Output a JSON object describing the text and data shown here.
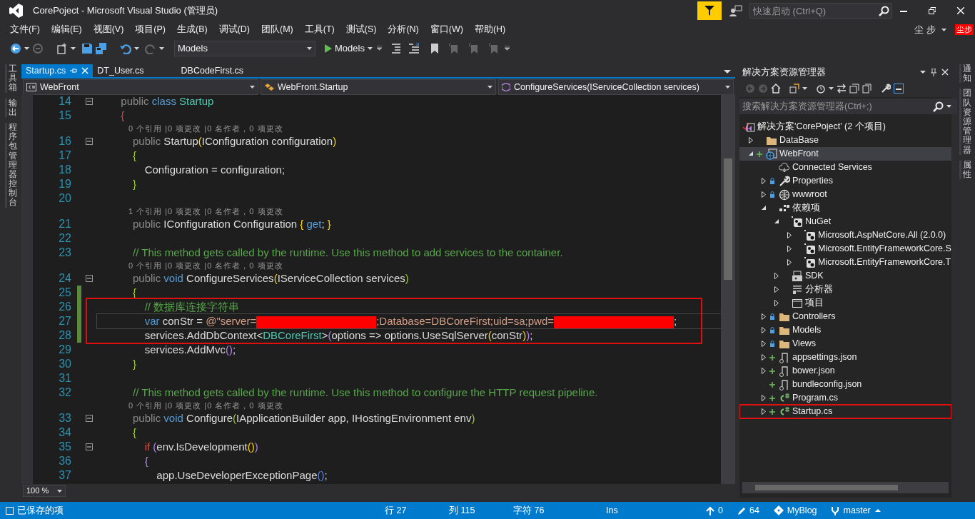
{
  "window": {
    "title": "CorePoject - Microsoft Visual Studio (管理员)",
    "quick_launch": {
      "placeholder": "快速启动 (Ctrl+Q)"
    },
    "user": "尘步",
    "avatar": "尘步"
  },
  "menu": [
    "文件(F)",
    "编辑(E)",
    "视图(V)",
    "项目(P)",
    "生成(B)",
    "调试(D)",
    "团队(M)",
    "工具(T)",
    "测试(S)",
    "分析(N)",
    "窗口(W)",
    "帮助(H)"
  ],
  "toolbar": {
    "configuration": "Models",
    "start": "Models"
  },
  "left_tool_tabs": [
    "工具箱",
    "输出",
    "程序包管理器控制台"
  ],
  "tabs": [
    {
      "label": "Startup.cs",
      "selected": true
    },
    {
      "label": "DT_User.cs",
      "selected": false
    },
    {
      "label": "DBCodeFirst.cs",
      "selected": false
    }
  ],
  "navigation": {
    "project": "WebFront",
    "type": "WebFront.Startup",
    "member": "ConfigureServices(IServiceCollection services)"
  },
  "code": [
    {
      "kind": "line",
      "number": "14",
      "fold": true,
      "changed": false,
      "current": false,
      "boxed": false,
      "tokens": [
        {
          "kind": "mod",
          "text": "        public"
        },
        {
          "kind": "kw",
          "text": " class"
        },
        {
          "kind": "type",
          "text": " Startup"
        }
      ]
    },
    {
      "kind": "line",
      "number": "15",
      "fold": false,
      "changed": false,
      "current": false,
      "boxed": false,
      "tokens": [
        {
          "kind": "br-red",
          "text": "        {"
        }
      ]
    },
    {
      "kind": "lens",
      "text": "0 个引用 |0 项更改 |0 名作者，0 项更改"
    },
    {
      "kind": "line",
      "number": "16",
      "fold": true,
      "changed": false,
      "current": false,
      "boxed": false,
      "tokens": [
        {
          "kind": "mod",
          "text": "            public"
        },
        {
          "kind": "text",
          "text": " Startup"
        },
        {
          "kind": "br-gold",
          "text": "("
        },
        {
          "kind": "text",
          "text": "IConfiguration configuration"
        },
        {
          "kind": "br-gold",
          "text": ")"
        }
      ]
    },
    {
      "kind": "line",
      "number": "17",
      "fold": false,
      "changed": false,
      "current": false,
      "boxed": false,
      "tokens": [
        {
          "kind": "br-green",
          "text": "            {"
        }
      ]
    },
    {
      "kind": "line",
      "number": "18",
      "fold": false,
      "changed": false,
      "current": false,
      "boxed": false,
      "tokens": [
        {
          "kind": "text",
          "text": "                Configuration = configuration;"
        }
      ]
    },
    {
      "kind": "line",
      "number": "19",
      "fold": false,
      "changed": false,
      "current": false,
      "boxed": false,
      "tokens": [
        {
          "kind": "br-green",
          "text": "            }"
        }
      ]
    },
    {
      "kind": "line",
      "number": "20",
      "fold": false,
      "changed": false,
      "current": false,
      "boxed": false
    },
    {
      "kind": "lens",
      "text": "1 个引用 |0 项更改 |0 名作者，0 项更改"
    },
    {
      "kind": "line",
      "number": "21",
      "fold": false,
      "changed": false,
      "current": false,
      "boxed": false,
      "tokens": [
        {
          "kind": "mod",
          "text": "            public"
        },
        {
          "kind": "text",
          "text": " IConfiguration Configuration "
        },
        {
          "kind": "br-gold",
          "text": "{"
        },
        {
          "kind": "kw",
          "text": " get"
        },
        {
          "kind": "text",
          "text": "; "
        },
        {
          "kind": "br-gold",
          "text": "}"
        }
      ]
    },
    {
      "kind": "line",
      "number": "22",
      "fold": false,
      "changed": false,
      "current": false,
      "boxed": false
    },
    {
      "kind": "line",
      "number": "23",
      "fold": false,
      "changed": false,
      "current": false,
      "boxed": false,
      "tokens": [
        {
          "kind": "comment",
          "text": "            // This method gets called by the runtime. Use this method to add services to the container."
        }
      ]
    },
    {
      "kind": "lens",
      "text": "0 个引用 |0 项更改 |0 名作者，0 项更改"
    },
    {
      "kind": "line",
      "number": "24",
      "fold": true,
      "changed": false,
      "current": false,
      "boxed": false,
      "tokens": [
        {
          "kind": "mod",
          "text": "            public"
        },
        {
          "kind": "kw",
          "text": " void"
        },
        {
          "kind": "text",
          "text": " ConfigureServices"
        },
        {
          "kind": "br-gold",
          "text": "("
        },
        {
          "kind": "text",
          "text": "IServiceCollection services"
        },
        {
          "kind": "br-green",
          "text": ")"
        }
      ]
    },
    {
      "kind": "line",
      "number": "25",
      "fold": false,
      "changed": true,
      "current": false,
      "boxed": false,
      "tokens": [
        {
          "kind": "br-green",
          "text": "            {"
        }
      ]
    },
    {
      "kind": "line",
      "number": "26",
      "fold": false,
      "changed": true,
      "current": false,
      "boxed": true,
      "tokens": [
        {
          "kind": "comment",
          "text": "                // 数据库连接字符串"
        }
      ]
    },
    {
      "kind": "line",
      "number": "27",
      "fold": false,
      "changed": true,
      "current": true,
      "boxed": true,
      "tokens": [
        {
          "kind": "kw",
          "text": "                var"
        },
        {
          "kind": "text",
          "text": " conStr = "
        },
        {
          "kind": "str",
          "text": "@\"server="
        },
        {
          "kind": "redact"
        },
        {
          "kind": "str",
          "text": ";Database=DBCoreFirst;uid=sa;pwd="
        },
        {
          "kind": "redact"
        },
        {
          "kind": "text",
          "text": ";"
        }
      ]
    },
    {
      "kind": "line",
      "number": "28",
      "fold": false,
      "changed": true,
      "current": false,
      "boxed": true,
      "tokens": [
        {
          "kind": "text",
          "text": "                services.AddDbContext<"
        },
        {
          "kind": "type",
          "text": "DBCoreFirst"
        },
        {
          "kind": "text",
          "text": ">"
        },
        {
          "kind": "br-purple",
          "text": "("
        },
        {
          "kind": "text",
          "text": "options => options.UseSqlServer"
        },
        {
          "kind": "br-gold",
          "text": "("
        },
        {
          "kind": "text",
          "text": "conStr"
        },
        {
          "kind": "br-gold",
          "text": ")"
        },
        {
          "kind": "br-purple",
          "text": ")"
        },
        {
          "kind": "text",
          "text": ";"
        }
      ]
    },
    {
      "kind": "line",
      "number": "29",
      "fold": false,
      "changed": false,
      "current": false,
      "boxed": false,
      "tokens": [
        {
          "kind": "text",
          "text": "                services.AddMvc"
        },
        {
          "kind": "br-purple",
          "text": "()"
        },
        {
          "kind": "text",
          "text": ";"
        }
      ]
    },
    {
      "kind": "line",
      "number": "30",
      "fold": false,
      "changed": false,
      "current": false,
      "boxed": false,
      "tokens": [
        {
          "kind": "br-green",
          "text": "            }"
        }
      ]
    },
    {
      "kind": "line",
      "number": "31",
      "fold": false,
      "changed": false,
      "current": false,
      "boxed": false
    },
    {
      "kind": "line",
      "number": "32",
      "fold": false,
      "changed": false,
      "current": false,
      "boxed": false,
      "tokens": [
        {
          "kind": "comment",
          "text": "            // This method gets called by the runtime. Use this method to configure the HTTP request pipeline."
        }
      ]
    },
    {
      "kind": "lens",
      "text": "0 个引用 |0 项更改 |0 名作者，0 项更改"
    },
    {
      "kind": "line",
      "number": "33",
      "fold": true,
      "changed": false,
      "current": false,
      "boxed": false,
      "tokens": [
        {
          "kind": "mod",
          "text": "            public"
        },
        {
          "kind": "kw",
          "text": " void"
        },
        {
          "kind": "text",
          "text": " Configure"
        },
        {
          "kind": "br-green",
          "text": "("
        },
        {
          "kind": "text",
          "text": "IApplicationBuilder app, IHostingEnvironment env"
        },
        {
          "kind": "br-green",
          "text": ")"
        }
      ]
    },
    {
      "kind": "line",
      "number": "34",
      "fold": false,
      "changed": false,
      "current": false,
      "boxed": false,
      "tokens": [
        {
          "kind": "br-green",
          "text": "            {"
        }
      ]
    },
    {
      "kind": "line",
      "number": "35",
      "fold": true,
      "changed": false,
      "current": false,
      "boxed": false,
      "tokens": [
        {
          "kind": "ctl",
          "text": "                if"
        },
        {
          "kind": "br-purple",
          "text": " ("
        },
        {
          "kind": "text",
          "text": "env.IsDevelopment"
        },
        {
          "kind": "br-gold",
          "text": "()"
        },
        {
          "kind": "br-purple",
          "text": ")"
        }
      ]
    },
    {
      "kind": "line",
      "number": "36",
      "fold": false,
      "changed": false,
      "current": false,
      "boxed": false,
      "tokens": [
        {
          "kind": "br-purple",
          "text": "                {"
        }
      ]
    },
    {
      "kind": "line",
      "number": "37",
      "fold": false,
      "changed": false,
      "current": false,
      "boxed": false,
      "tokens": [
        {
          "kind": "text",
          "text": "                    app.UseDeveloperExceptionPage"
        },
        {
          "kind": "br-blue",
          "text": "()"
        },
        {
          "kind": "text",
          "text": ";"
        }
      ]
    }
  ],
  "zoom": "100 %",
  "solution_explorer": {
    "title": "解决方案资源管理器",
    "search": {
      "placeholder": "搜索解决方案资源管理器(Ctrl+;)"
    },
    "root": {
      "label": "解决方案'CorePoject' (2 个项目)",
      "children": [
        {
          "label": "DataBase",
          "kind": "folder",
          "expanded": false,
          "locked": false,
          "added": false,
          "selected": false,
          "boxed": false
        },
        {
          "label": "WebFront",
          "kind": "web-project",
          "expanded": true,
          "locked": false,
          "added": true,
          "selected": true,
          "boxed": false,
          "children": [
            {
              "label": "Connected Services",
              "kind": "cloud",
              "locked": false,
              "added": false,
              "selected": false,
              "boxed": false
            },
            {
              "label": "Properties",
              "kind": "wrench",
              "expanded": false,
              "locked": true,
              "added": false,
              "selected": false,
              "boxed": false
            },
            {
              "label": "wwwroot",
              "kind": "globe",
              "expanded": false,
              "locked": true,
              "added": false,
              "selected": false,
              "boxed": false
            },
            {
              "label": "依赖项",
              "kind": "dependencies",
              "expanded": true,
              "locked": false,
              "added": false,
              "selected": false,
              "boxed": false,
              "children": [
                {
                  "label": "NuGet",
                  "kind": "package",
                  "expanded": true,
                  "locked": false,
                  "added": false,
                  "selected": false,
                  "boxed": false,
                  "children": [
                    {
                      "label": "Microsoft.AspNetCore.All (2.0.0)",
                      "kind": "package",
                      "expanded": false,
                      "locked": false,
                      "added": false,
                      "selected": false,
                      "boxed": false
                    },
                    {
                      "label": "Microsoft.EntityFrameworkCore.S",
                      "kind": "package",
                      "expanded": false,
                      "locked": false,
                      "added": false,
                      "selected": false,
                      "boxed": false
                    },
                    {
                      "label": "Microsoft.EntityFrameworkCore.T",
                      "kind": "package",
                      "expanded": false,
                      "locked": false,
                      "added": false,
                      "selected": false,
                      "boxed": false
                    }
                  ]
                },
                {
                  "label": "SDK",
                  "kind": "sdk",
                  "expanded": false,
                  "locked": false,
                  "added": false,
                  "selected": false,
                  "boxed": false
                },
                {
                  "label": "分析器",
                  "kind": "analyzer",
                  "expanded": false,
                  "locked": false,
                  "added": false,
                  "selected": false,
                  "boxed": false
                },
                {
                  "label": "项目",
                  "kind": "window",
                  "expanded": false,
                  "locked": false,
                  "added": false,
                  "selected": false,
                  "boxed": false
                }
              ]
            },
            {
              "label": "Controllers",
              "kind": "folder",
              "expanded": false,
              "locked": true,
              "added": false,
              "selected": false,
              "boxed": false
            },
            {
              "label": "Models",
              "kind": "folder",
              "expanded": false,
              "locked": true,
              "added": false,
              "selected": false,
              "boxed": false
            },
            {
              "label": "Views",
              "kind": "folder",
              "expanded": false,
              "locked": true,
              "added": false,
              "selected": false,
              "boxed": false
            },
            {
              "label": "appsettings.json",
              "kind": "json",
              "expanded": false,
              "locked": false,
              "added": true,
              "selected": false,
              "boxed": false
            },
            {
              "label": "bower.json",
              "kind": "json",
              "expanded": false,
              "locked": false,
              "added": true,
              "selected": false,
              "boxed": false
            },
            {
              "label": "bundleconfig.json",
              "kind": "json",
              "locked": false,
              "added": true,
              "selected": false,
              "boxed": false
            },
            {
              "label": "Program.cs",
              "kind": "csharp",
              "expanded": false,
              "locked": false,
              "added": true,
              "selected": false,
              "boxed": false
            },
            {
              "label": "Startup.cs",
              "kind": "csharp",
              "expanded": false,
              "locked": false,
              "added": true,
              "selected": false,
              "boxed": true
            }
          ]
        }
      ]
    }
  },
  "right_tool_tabs": [
    "通知",
    "团队资源管理器",
    "属性"
  ],
  "status_bar": {
    "message": "已保存的项",
    "line": "行 27",
    "column": "列 115",
    "character": "字符 76",
    "mode": "Ins",
    "pushes": "0",
    "changes": "64",
    "repository": "MyBlog",
    "branch": "master"
  }
}
